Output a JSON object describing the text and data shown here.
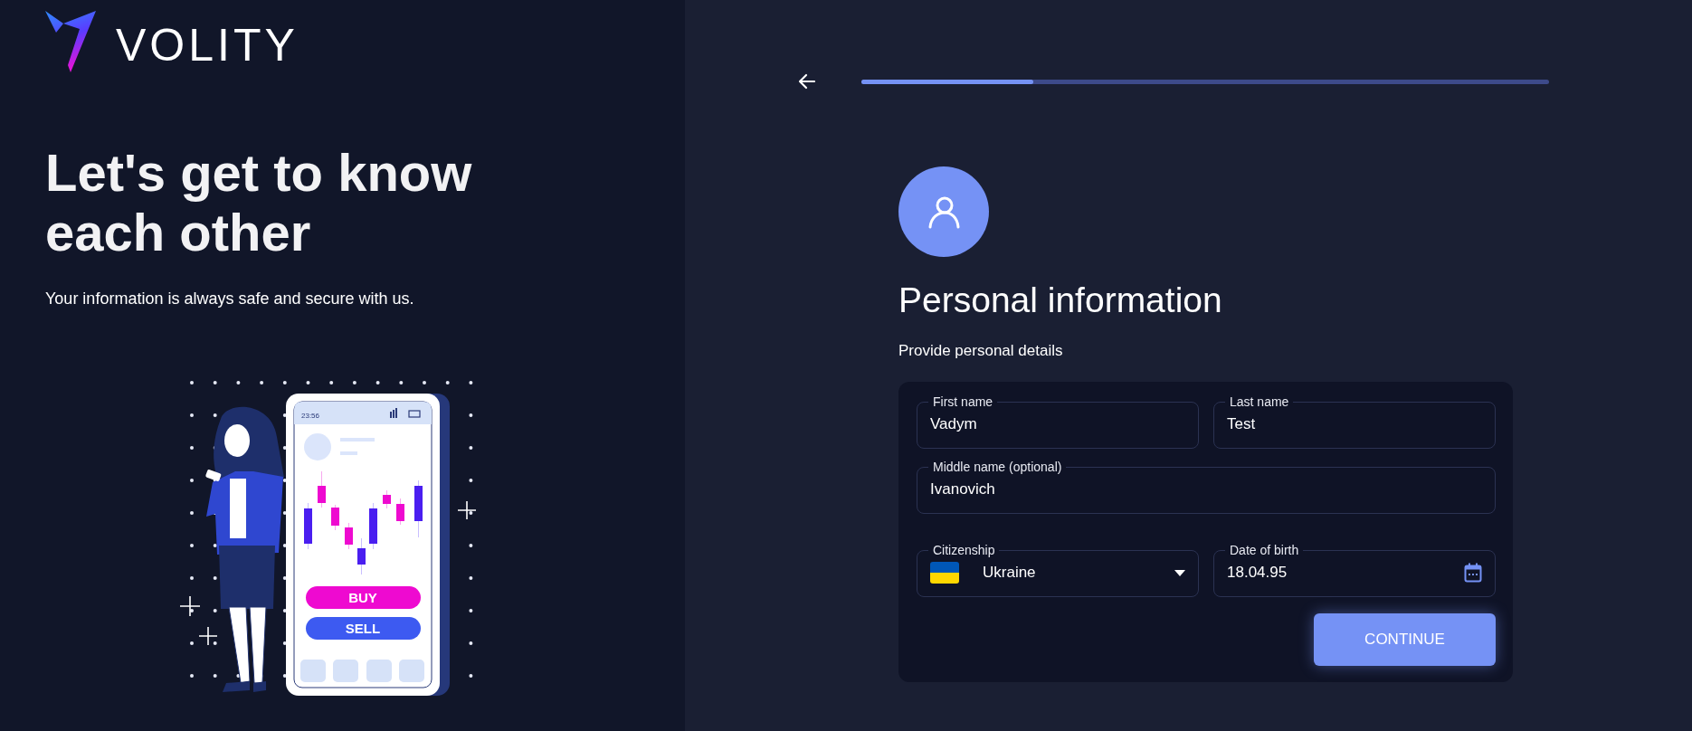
{
  "brand": {
    "name": "VOLITY"
  },
  "intro": {
    "title": "Let's get to know each other",
    "subtitle": "Your information is always safe and secure with us."
  },
  "illustration": {
    "phone_time": "23:56",
    "buy_label": "BUY",
    "sell_label": "SELL"
  },
  "progress": {
    "level": 0.25
  },
  "section": {
    "title": "Personal information",
    "subtitle": "Provide personal details"
  },
  "form": {
    "rows": [
      {
        "fields": [
          {
            "kind": "text",
            "label": "First name",
            "value": "Vadym"
          },
          {
            "kind": "text",
            "label": "Last name",
            "value": "Test"
          }
        ]
      },
      {
        "fields": [
          {
            "kind": "text",
            "label": "Middle name (optional)",
            "value": "Ivanovich"
          }
        ]
      },
      {
        "fields": [
          {
            "kind": "select",
            "label": "Citizenship",
            "value": "Ukraine"
          },
          {
            "kind": "date",
            "label": "Date of birth",
            "value": "18.04.95"
          }
        ]
      }
    ],
    "submit": "CONTINUE"
  }
}
